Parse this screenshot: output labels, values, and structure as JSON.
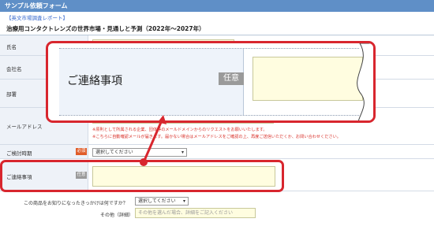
{
  "header": {
    "title": "サンプル依頼フォーム"
  },
  "report_tag": "【英文市場調査レポート】",
  "product_title": "治療用コンタクトレンズの世界市場・見通しと予測（2022年～2027年）",
  "fields": {
    "name": {
      "label": "氏名"
    },
    "company": {
      "label": "会社名"
    },
    "department": {
      "label": "部署"
    },
    "email": {
      "label": "メールアドレス",
      "note1": "※原則として所属される企業、団体等のメールドメインからのリクエストをお願いいたします。",
      "note2": "※こちらに自動確認メールが届きます。届かない場合はメールアドレスをご確認の上、再度ご送信いただくか、お問い合わせください。"
    },
    "timing": {
      "label": "ご検討時期",
      "badge": "必須",
      "select_value": "選択してください"
    },
    "contact": {
      "label": "ご連絡事項",
      "badge": "任意"
    },
    "source": {
      "label": "この商品をお知りになったきっかけは何ですか？",
      "select_value": "選択してください"
    },
    "other": {
      "label": "その他（詳細）",
      "placeholder": "その他を選んだ場合、詳細をご記入ください"
    }
  },
  "zoom": {
    "label": "ご連絡事項",
    "badge": "任意"
  },
  "colors": {
    "highlight": "#d8262e",
    "header": "#5f8fc7",
    "field_bg": "#fffde0",
    "label_bg": "#eef2f8"
  }
}
